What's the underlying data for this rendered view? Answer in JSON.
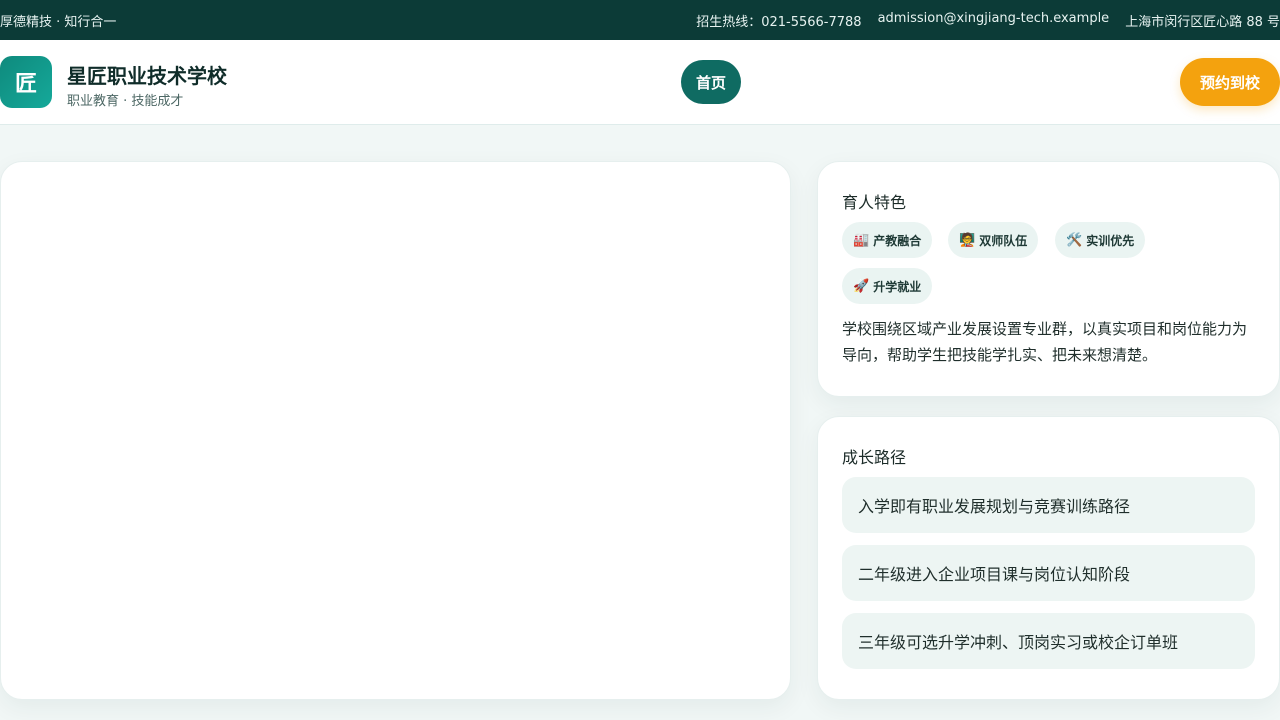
{
  "topbar": {
    "slogan": "厚德精技 · 知行合一",
    "hotline": "招生热线：021-5566-7788",
    "email": "admission@xingjiang-tech.example",
    "address": "上海市闵行区匠心路 88 号"
  },
  "header": {
    "logo_char": "匠",
    "school_name": "星匠职业技术学校",
    "tagline": "职业教育 · 技能成才",
    "nav_home": "首页",
    "cta_label": "预约到校"
  },
  "features": {
    "title": "育人特色",
    "tags": [
      {
        "icon": "🏭",
        "label": "产教融合"
      },
      {
        "icon": "🧑‍🏫",
        "label": "双师队伍"
      },
      {
        "icon": "🛠️",
        "label": "实训优先"
      },
      {
        "icon": "🚀",
        "label": "升学就业"
      }
    ],
    "description": "学校围绕区域产业发展设置专业群，以真实项目和岗位能力为导向，帮助学生把技能学扎实、把未来想清楚。"
  },
  "growth": {
    "title": "成长路径",
    "steps": [
      "入学即有职业发展规划与竞赛训练路径",
      "二年级进入企业项目课与岗位认知阶段",
      "三年级可选升学冲刺、顶岗实习或校企订单班"
    ]
  },
  "colors": {
    "topbar": "#0c3b37",
    "primary": "#0f6b62",
    "accent": "#f4a20e"
  }
}
